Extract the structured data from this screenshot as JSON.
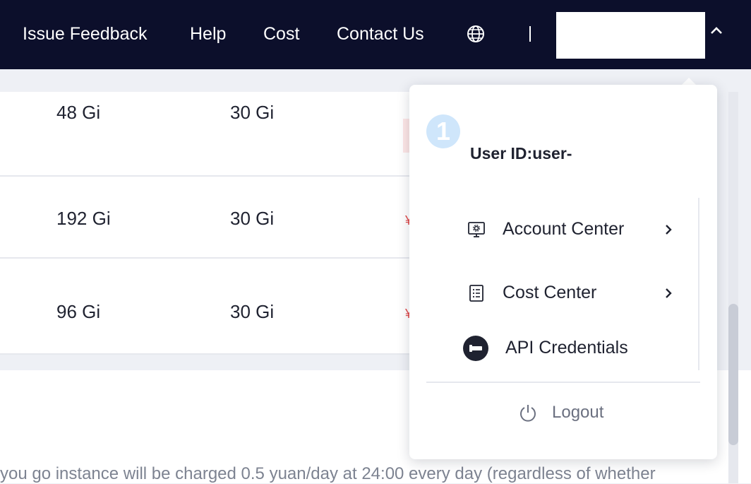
{
  "header": {
    "nav": [
      "Issue Feedback",
      "Help",
      "Cost",
      "Contact Us"
    ],
    "globe_icon": "globe-icon",
    "separator": "|",
    "caret_icon": "chevron-up-icon"
  },
  "table": {
    "rows": [
      {
        "memory": "48 Gi",
        "disk": "30 Gi"
      },
      {
        "memory": "192 Gi",
        "disk": "30 Gi"
      },
      {
        "memory": "96 Gi",
        "disk": "30 Gi"
      }
    ],
    "red_mark": "¥"
  },
  "footer_note": "you go instance will be charged 0.5 yuan/day at 24:00 every day (regardless of whether",
  "user_menu": {
    "badge": "1",
    "user_id_label": "User ID:user-",
    "items": [
      {
        "label": "Account Center",
        "icon": "monitor-settings-icon",
        "has_submenu": true
      },
      {
        "label": "Cost Center",
        "icon": "list-document-icon",
        "has_submenu": true
      },
      {
        "label": "API Credentials",
        "icon": "key-icon",
        "has_submenu": false
      }
    ],
    "logout_label": "Logout",
    "logout_icon": "power-icon"
  },
  "colors": {
    "header_bg": "#0c0f2b",
    "page_bg": "#eef0f5",
    "badge_bg": "#cfe6fb",
    "muted_text": "#6b7080"
  }
}
